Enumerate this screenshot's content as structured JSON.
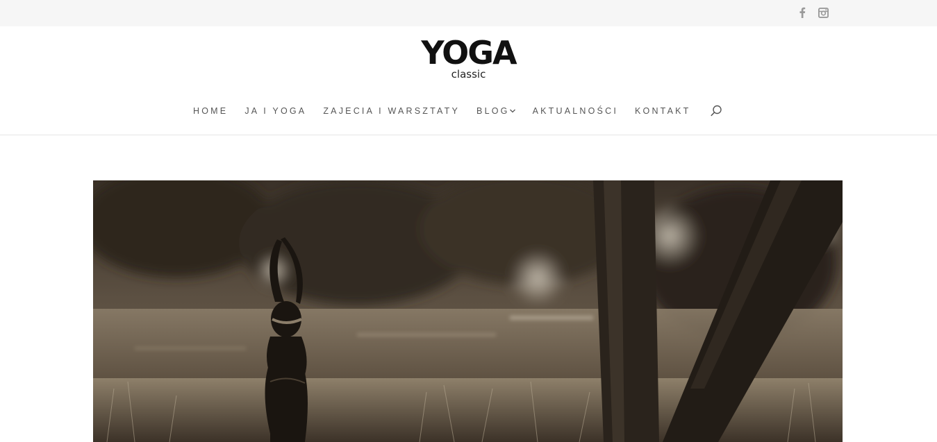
{
  "topbar": {
    "social": [
      {
        "icon": "facebook-icon"
      },
      {
        "icon": "instagram-icon"
      }
    ]
  },
  "logo": {
    "main": "YOGA",
    "sub": "classic"
  },
  "nav": {
    "items": [
      {
        "label": "HOME"
      },
      {
        "label": "JA I YOGA"
      },
      {
        "label": "ZAJECIA I WARSZTATY"
      },
      {
        "label": "BLOG",
        "has_dropdown": true
      },
      {
        "label": "AKTUALNOŚCI"
      },
      {
        "label": "KONTAKT"
      }
    ],
    "search_icon": "search-icon"
  },
  "hero": {
    "image": "sepia photo of woman in yoga pose by a lake under trees"
  },
  "colors": {
    "topbar_bg": "#f6f6f6",
    "nav_text": "#555555",
    "icon_gray": "#9a9a9a",
    "logo_text": "#111111"
  }
}
